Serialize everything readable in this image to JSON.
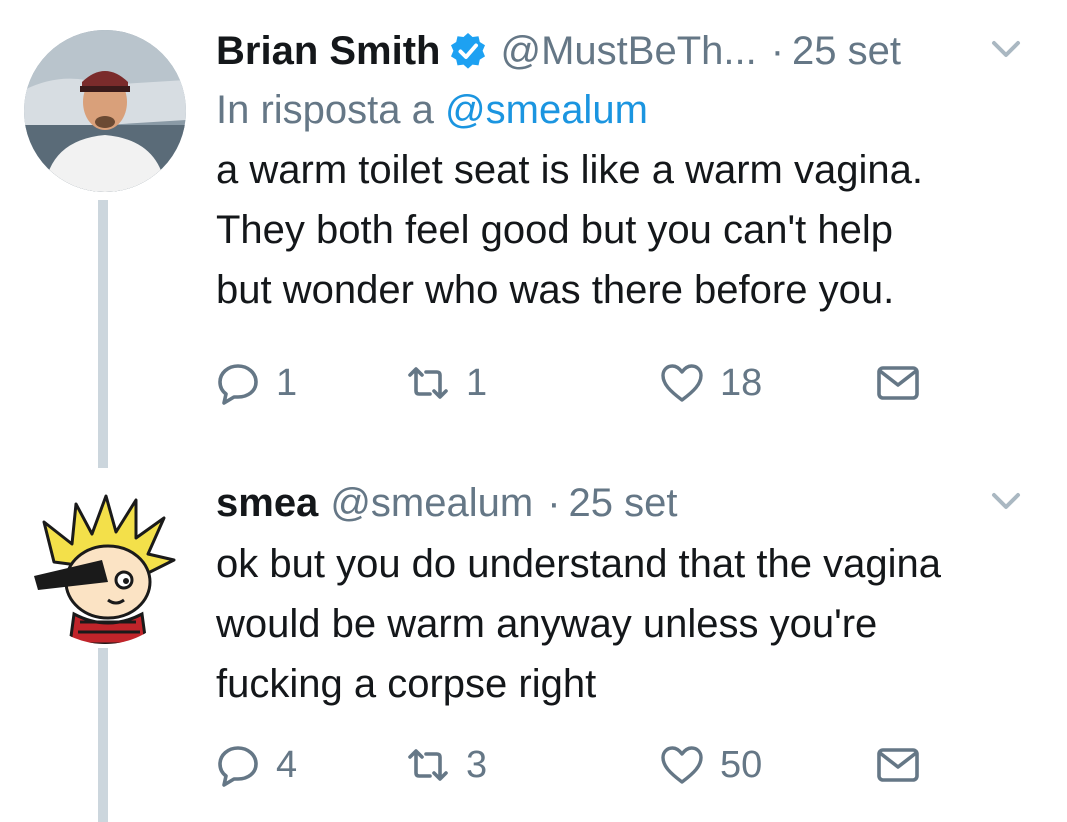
{
  "tweets": [
    {
      "name": "Brian Smith",
      "handle": "@MustBeTh...",
      "date": "25 set",
      "dot": "·",
      "reply_prefix": "In risposta a",
      "reply_mention": "@smealum",
      "lines": [
        "a warm toilet seat is like a warm vagina.",
        "They both feel good but you can't help",
        "but wonder who was there before you."
      ],
      "replies": "1",
      "retweets": "1",
      "likes": "18",
      "verified": true
    },
    {
      "name": "smea",
      "handle": "@smealum",
      "date": "25 set",
      "dot": "·",
      "lines": [
        "ok but you do understand that the vagina",
        "would be warm anyway unless you're",
        "fucking a corpse right"
      ],
      "replies": "4",
      "retweets": "3",
      "likes": "50",
      "verified": false
    }
  ],
  "icons": {
    "verified": "verified-badge-icon",
    "caret": "chevron-down-icon",
    "reply": "reply-bubble-icon",
    "retweet": "retweet-icon",
    "like": "heart-icon",
    "message": "envelope-icon"
  },
  "colors": {
    "text": "#14171a",
    "muted": "#657786",
    "link": "#1b95e0",
    "thread_line": "#ccd6dd",
    "verified": "#1da1f2"
  }
}
